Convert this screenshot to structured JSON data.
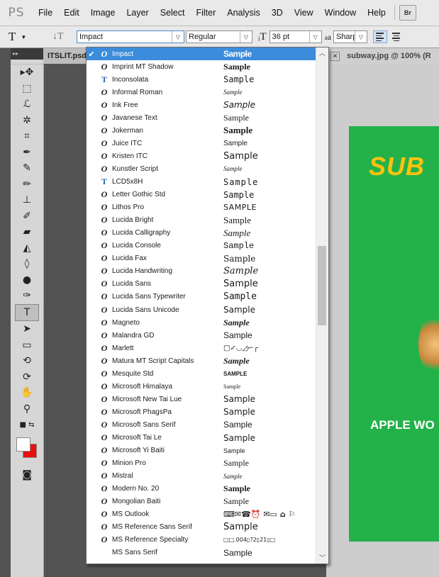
{
  "app": {
    "logo": "PS"
  },
  "menubar": {
    "items": [
      "File",
      "Edit",
      "Image",
      "Layer",
      "Select",
      "Filter",
      "Analysis",
      "3D",
      "View",
      "Window",
      "Help"
    ],
    "bridge_button": "Br"
  },
  "options": {
    "font_family": "Impact",
    "font_style": "Regular",
    "font_size": "36 pt",
    "aa_label": "a",
    "aa_label_sub": "a",
    "antialias": "Sharp"
  },
  "tabs": {
    "left": "ITSLIT.psd",
    "right": "subway.jpg @ 100% (R"
  },
  "image": {
    "logo_text": "SUB",
    "tagline": "APPLE WO"
  },
  "font_list": [
    {
      "name": "Impact",
      "sample": "Sample",
      "type": "O",
      "selected": true
    },
    {
      "name": "Imprint MT Shadow",
      "sample": "Sample",
      "type": "O"
    },
    {
      "name": "Inconsolata",
      "sample": "Sample",
      "type": "T"
    },
    {
      "name": "Informal Roman",
      "sample": "Sample",
      "type": "O"
    },
    {
      "name": "Ink Free",
      "sample": "Sample",
      "type": "O"
    },
    {
      "name": "Javanese Text",
      "sample": "Sample",
      "type": "O"
    },
    {
      "name": "Jokerman",
      "sample": "Sample",
      "type": "O"
    },
    {
      "name": "Juice ITC",
      "sample": "Sample",
      "type": "O"
    },
    {
      "name": "Kristen ITC",
      "sample": "Sample",
      "type": "O"
    },
    {
      "name": "Kunstler Script",
      "sample": "Sample",
      "type": "O"
    },
    {
      "name": "LCD5x8H",
      "sample": "Sample",
      "type": "T"
    },
    {
      "name": "Letter Gothic Std",
      "sample": "Sample",
      "type": "O"
    },
    {
      "name": "Lithos Pro",
      "sample": "SAMPLE",
      "type": "O"
    },
    {
      "name": "Lucida Bright",
      "sample": "Sample",
      "type": "O"
    },
    {
      "name": "Lucida Calligraphy",
      "sample": "Sample",
      "type": "O"
    },
    {
      "name": "Lucida Console",
      "sample": "Sample",
      "type": "O"
    },
    {
      "name": "Lucida Fax",
      "sample": "Sample",
      "type": "O"
    },
    {
      "name": "Lucida Handwriting",
      "sample": "Sample",
      "type": "O"
    },
    {
      "name": "Lucida Sans",
      "sample": "Sample",
      "type": "O"
    },
    {
      "name": "Lucida Sans Typewriter",
      "sample": "Sample",
      "type": "O"
    },
    {
      "name": "Lucida Sans Unicode",
      "sample": "Sample",
      "type": "O"
    },
    {
      "name": "Magneto",
      "sample": "Sample",
      "type": "O"
    },
    {
      "name": "Malandra GD",
      "sample": "Sample",
      "type": "O"
    },
    {
      "name": "Marlett",
      "sample": "□✓◡◿⌐┌",
      "type": "O"
    },
    {
      "name": "Matura MT Script Capitals",
      "sample": "Sample",
      "type": "O"
    },
    {
      "name": "Mesquite Std",
      "sample": "SAMPLE",
      "type": "O"
    },
    {
      "name": "Microsoft Himalaya",
      "sample": "Sample",
      "type": "O"
    },
    {
      "name": "Microsoft New Tai Lue",
      "sample": "Sample",
      "type": "O"
    },
    {
      "name": "Microsoft PhagsPa",
      "sample": "Sample",
      "type": "O"
    },
    {
      "name": "Microsoft Sans Serif",
      "sample": "Sample",
      "type": "O"
    },
    {
      "name": "Microsoft Tai Le",
      "sample": "Sample",
      "type": "O"
    },
    {
      "name": "Microsoft Yi Baiti",
      "sample": "Sample",
      "type": "O"
    },
    {
      "name": "Minion Pro",
      "sample": "Sample",
      "type": "O"
    },
    {
      "name": "Mistral",
      "sample": "Sample",
      "type": "O"
    },
    {
      "name": "Modern No. 20",
      "sample": "Sample",
      "type": "O"
    },
    {
      "name": "Mongolian Baiti",
      "sample": "Sample",
      "type": "O"
    },
    {
      "name": "MS Outlook",
      "sample": "⌨✉☎⏰ ✉▭ ⌂ ⚐",
      "type": "O"
    },
    {
      "name": "MS Reference Sans Serif",
      "sample": "Sample",
      "type": "O"
    },
    {
      "name": "MS Reference Specialty",
      "sample": "□□.004▯?2▯21▯□",
      "type": "O"
    },
    {
      "name": "MS Sans Serif",
      "sample": "Sample",
      "type": ""
    }
  ]
}
